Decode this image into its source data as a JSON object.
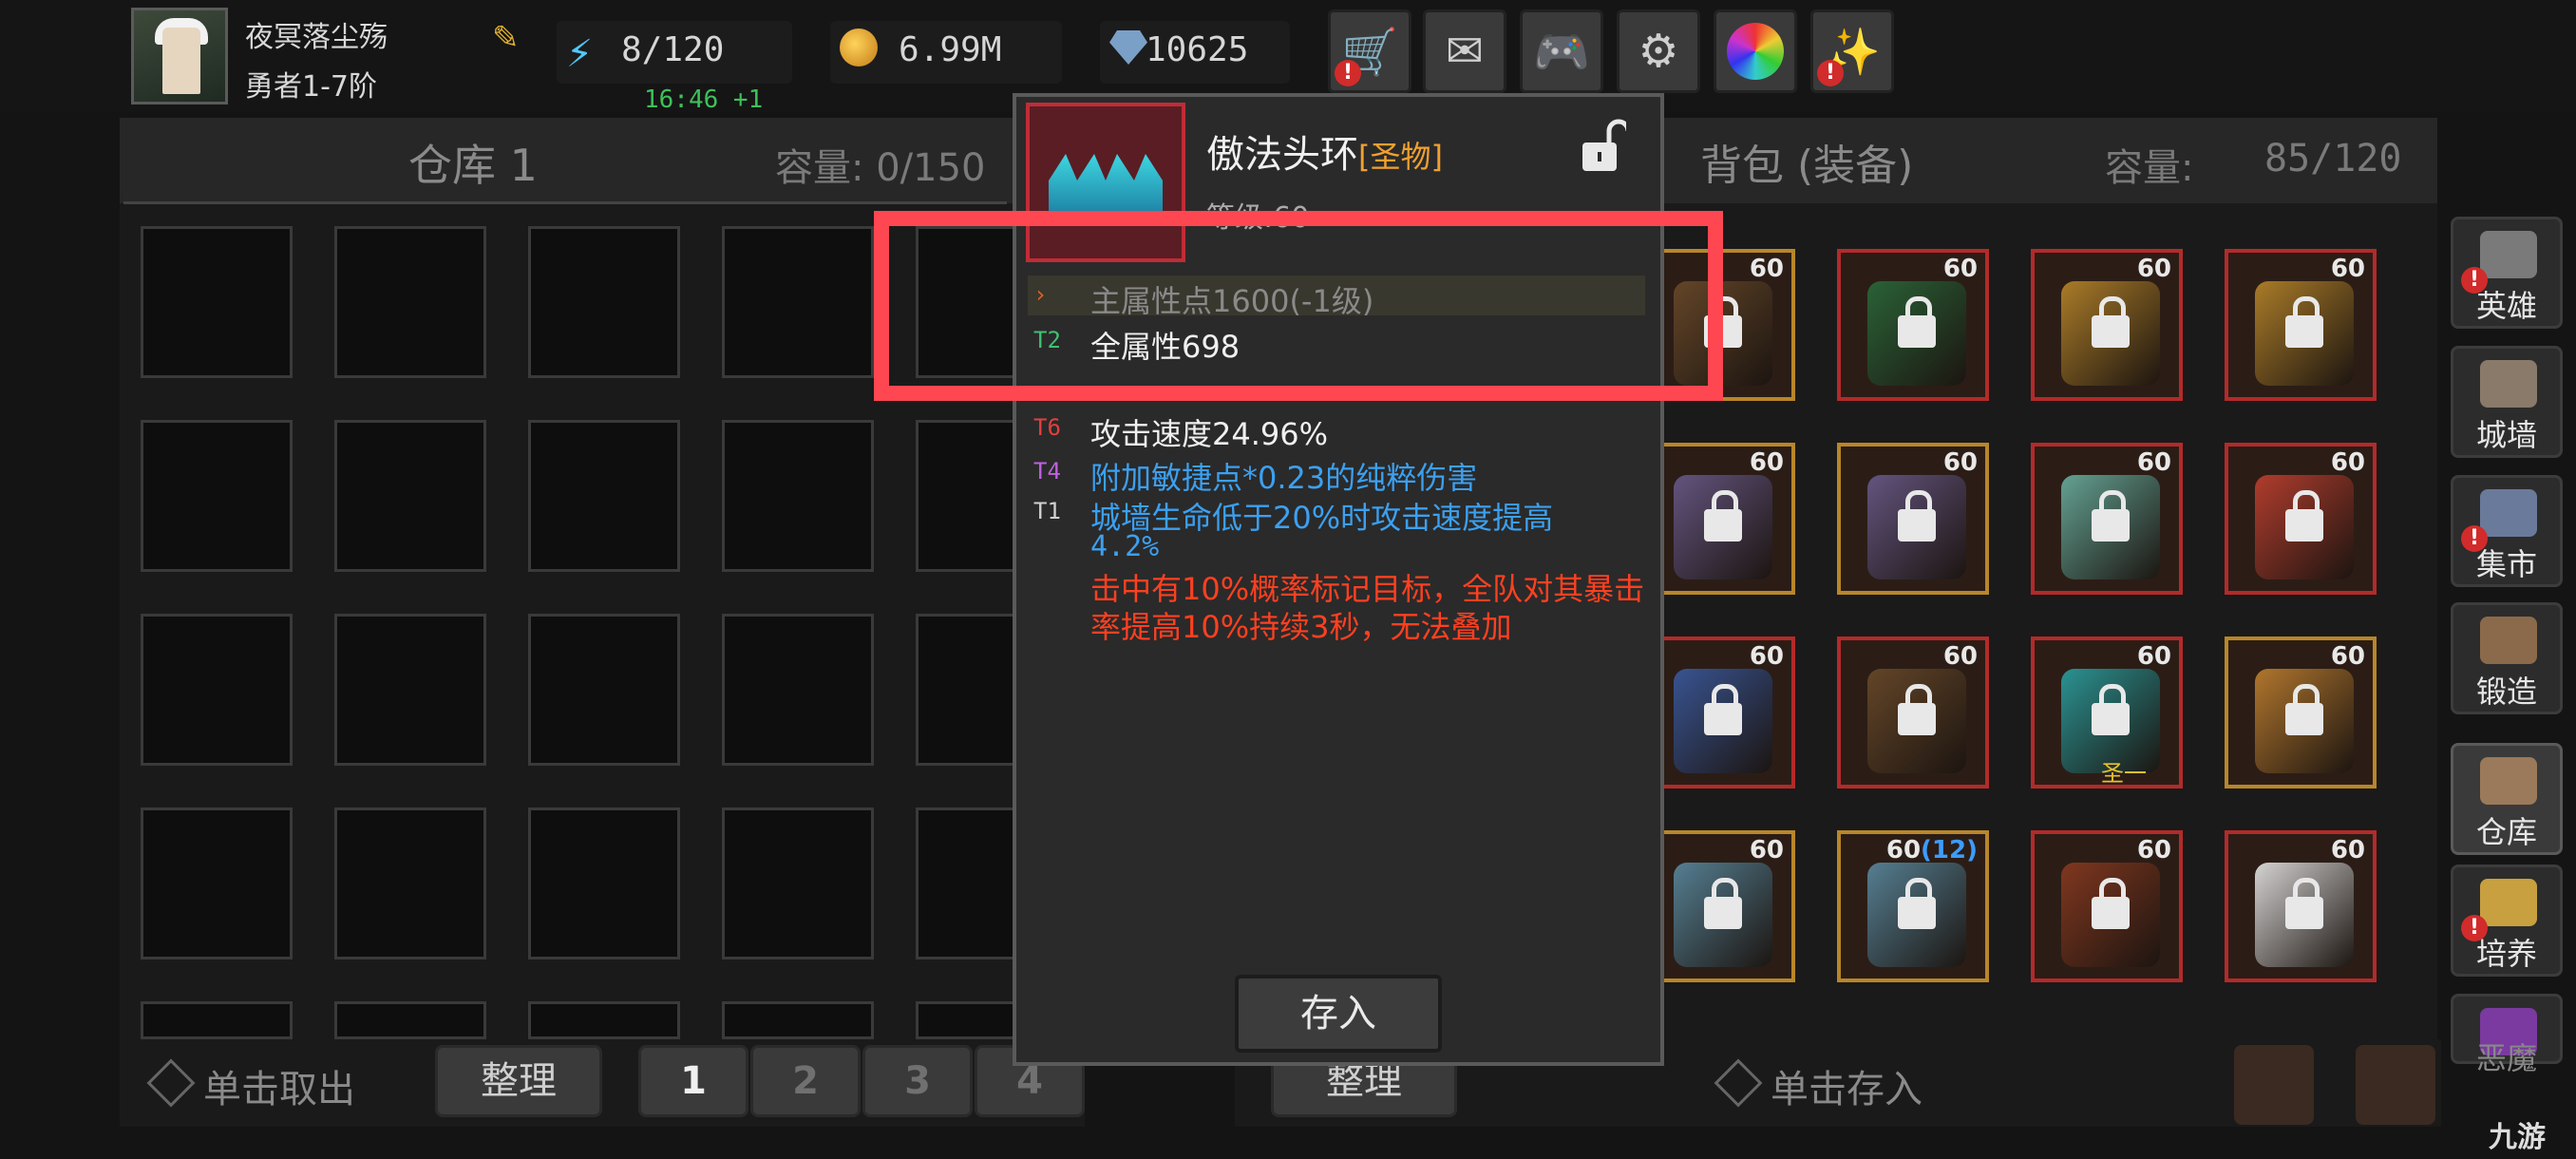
{
  "player": {
    "name": "夜冥落尘殇",
    "rank": "勇者1-7阶"
  },
  "resources": {
    "energy": "8/120",
    "timer": "16:46 +1",
    "gold": "6.99M",
    "gems": "10625"
  },
  "top_buttons": [
    "shop-cart-icon",
    "mail-icon",
    "gamepad-icon",
    "gear-icon",
    "color-wheel-icon",
    "firework-icon"
  ],
  "warehouse": {
    "title": "仓库 1",
    "capacity_label": "容量: 0/150"
  },
  "backpack": {
    "title": "背包 (装备)",
    "capacity_label": "容量:",
    "capacity_value": "85/120"
  },
  "bottom": {
    "take_hint": "单击取出",
    "sort_left": "整理",
    "pages": [
      "1",
      "2",
      "3",
      "4"
    ],
    "sort_right": "整理",
    "store_hint": "单击存入"
  },
  "tooltip": {
    "name": "傲法头环",
    "quality": "[圣物]",
    "level": "等级:60",
    "stats": [
      {
        "tier": "›",
        "text": "主属性点1600(-1级)",
        "tier_color": "#e06020",
        "text_color": "#8a8a8a"
      },
      {
        "tier": "T2",
        "text": "全属性698",
        "tier_color": "#40c070",
        "text_color": "#f0f0f0"
      },
      {
        "tier": "T6",
        "text": "攻击速度24.96%",
        "tier_color": "#e04040",
        "text_color": "#f0f0f0"
      },
      {
        "tier": "T4",
        "text": "附加敏捷点*0.23的纯粹伤害",
        "tier_color": "#c060e0",
        "text_color": "#3ca0f0"
      },
      {
        "tier": "T1",
        "text": "城墙生命低于20%时攻击速度提高",
        "tier_color": "#d0d0d0",
        "text_color": "#3ca0f0"
      }
    ],
    "stat_cont": "4.2%",
    "special": "击中有10%概率标记目标，全队对其暴击率提高10%持续3秒，无法叠加",
    "store_button": "存入"
  },
  "items": [
    {
      "level": "60",
      "border": "gold"
    },
    {
      "level": "60",
      "border": "red"
    },
    {
      "level": "60",
      "border": "red"
    },
    {
      "level": "60",
      "border": "red"
    },
    {
      "level": "60",
      "border": "gold"
    },
    {
      "level": "60",
      "border": "gold"
    },
    {
      "level": "60",
      "border": "red"
    },
    {
      "level": "60",
      "border": "red"
    },
    {
      "level": "60",
      "border": "red"
    },
    {
      "level": "60",
      "border": "red"
    },
    {
      "level": "60",
      "border": "red",
      "tag": "圣一"
    },
    {
      "level": "60",
      "border": "gold"
    },
    {
      "level": "60",
      "border": "gold"
    },
    {
      "level": "60",
      "extra": "(12)",
      "border": "gold"
    },
    {
      "level": "60",
      "border": "red"
    },
    {
      "level": "60",
      "border": "red"
    }
  ],
  "side_nav": [
    "英雄",
    "城墙",
    "集市",
    "锻造",
    "仓库",
    "培养",
    "恶魔"
  ],
  "watermark": "九游",
  "colors": {
    "highlight": "#ff4752",
    "relic": "#f0a030",
    "blue_text": "#3ca0f0",
    "red_text": "#ff4020"
  }
}
